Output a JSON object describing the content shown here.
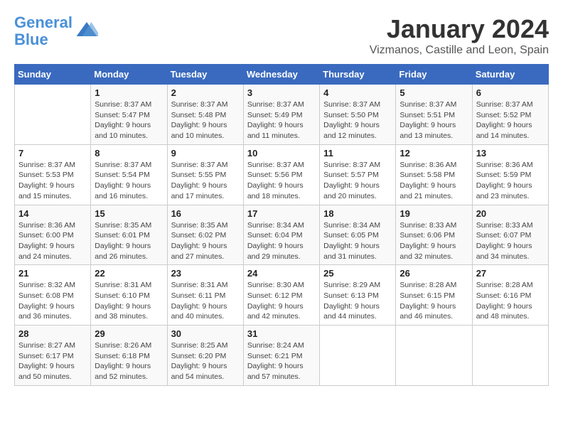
{
  "logo": {
    "line1": "General",
    "line2": "Blue"
  },
  "title": "January 2024",
  "location": "Vizmanos, Castille and Leon, Spain",
  "days_header": [
    "Sunday",
    "Monday",
    "Tuesday",
    "Wednesday",
    "Thursday",
    "Friday",
    "Saturday"
  ],
  "weeks": [
    [
      {
        "day": "",
        "info": ""
      },
      {
        "day": "1",
        "info": "Sunrise: 8:37 AM\nSunset: 5:47 PM\nDaylight: 9 hours\nand 10 minutes."
      },
      {
        "day": "2",
        "info": "Sunrise: 8:37 AM\nSunset: 5:48 PM\nDaylight: 9 hours\nand 10 minutes."
      },
      {
        "day": "3",
        "info": "Sunrise: 8:37 AM\nSunset: 5:49 PM\nDaylight: 9 hours\nand 11 minutes."
      },
      {
        "day": "4",
        "info": "Sunrise: 8:37 AM\nSunset: 5:50 PM\nDaylight: 9 hours\nand 12 minutes."
      },
      {
        "day": "5",
        "info": "Sunrise: 8:37 AM\nSunset: 5:51 PM\nDaylight: 9 hours\nand 13 minutes."
      },
      {
        "day": "6",
        "info": "Sunrise: 8:37 AM\nSunset: 5:52 PM\nDaylight: 9 hours\nand 14 minutes."
      }
    ],
    [
      {
        "day": "7",
        "info": "Sunrise: 8:37 AM\nSunset: 5:53 PM\nDaylight: 9 hours\nand 15 minutes."
      },
      {
        "day": "8",
        "info": "Sunrise: 8:37 AM\nSunset: 5:54 PM\nDaylight: 9 hours\nand 16 minutes."
      },
      {
        "day": "9",
        "info": "Sunrise: 8:37 AM\nSunset: 5:55 PM\nDaylight: 9 hours\nand 17 minutes."
      },
      {
        "day": "10",
        "info": "Sunrise: 8:37 AM\nSunset: 5:56 PM\nDaylight: 9 hours\nand 18 minutes."
      },
      {
        "day": "11",
        "info": "Sunrise: 8:37 AM\nSunset: 5:57 PM\nDaylight: 9 hours\nand 20 minutes."
      },
      {
        "day": "12",
        "info": "Sunrise: 8:36 AM\nSunset: 5:58 PM\nDaylight: 9 hours\nand 21 minutes."
      },
      {
        "day": "13",
        "info": "Sunrise: 8:36 AM\nSunset: 5:59 PM\nDaylight: 9 hours\nand 23 minutes."
      }
    ],
    [
      {
        "day": "14",
        "info": "Sunrise: 8:36 AM\nSunset: 6:00 PM\nDaylight: 9 hours\nand 24 minutes."
      },
      {
        "day": "15",
        "info": "Sunrise: 8:35 AM\nSunset: 6:01 PM\nDaylight: 9 hours\nand 26 minutes."
      },
      {
        "day": "16",
        "info": "Sunrise: 8:35 AM\nSunset: 6:02 PM\nDaylight: 9 hours\nand 27 minutes."
      },
      {
        "day": "17",
        "info": "Sunrise: 8:34 AM\nSunset: 6:04 PM\nDaylight: 9 hours\nand 29 minutes."
      },
      {
        "day": "18",
        "info": "Sunrise: 8:34 AM\nSunset: 6:05 PM\nDaylight: 9 hours\nand 31 minutes."
      },
      {
        "day": "19",
        "info": "Sunrise: 8:33 AM\nSunset: 6:06 PM\nDaylight: 9 hours\nand 32 minutes."
      },
      {
        "day": "20",
        "info": "Sunrise: 8:33 AM\nSunset: 6:07 PM\nDaylight: 9 hours\nand 34 minutes."
      }
    ],
    [
      {
        "day": "21",
        "info": "Sunrise: 8:32 AM\nSunset: 6:08 PM\nDaylight: 9 hours\nand 36 minutes."
      },
      {
        "day": "22",
        "info": "Sunrise: 8:31 AM\nSunset: 6:10 PM\nDaylight: 9 hours\nand 38 minutes."
      },
      {
        "day": "23",
        "info": "Sunrise: 8:31 AM\nSunset: 6:11 PM\nDaylight: 9 hours\nand 40 minutes."
      },
      {
        "day": "24",
        "info": "Sunrise: 8:30 AM\nSunset: 6:12 PM\nDaylight: 9 hours\nand 42 minutes."
      },
      {
        "day": "25",
        "info": "Sunrise: 8:29 AM\nSunset: 6:13 PM\nDaylight: 9 hours\nand 44 minutes."
      },
      {
        "day": "26",
        "info": "Sunrise: 8:28 AM\nSunset: 6:15 PM\nDaylight: 9 hours\nand 46 minutes."
      },
      {
        "day": "27",
        "info": "Sunrise: 8:28 AM\nSunset: 6:16 PM\nDaylight: 9 hours\nand 48 minutes."
      }
    ],
    [
      {
        "day": "28",
        "info": "Sunrise: 8:27 AM\nSunset: 6:17 PM\nDaylight: 9 hours\nand 50 minutes."
      },
      {
        "day": "29",
        "info": "Sunrise: 8:26 AM\nSunset: 6:18 PM\nDaylight: 9 hours\nand 52 minutes."
      },
      {
        "day": "30",
        "info": "Sunrise: 8:25 AM\nSunset: 6:20 PM\nDaylight: 9 hours\nand 54 minutes."
      },
      {
        "day": "31",
        "info": "Sunrise: 8:24 AM\nSunset: 6:21 PM\nDaylight: 9 hours\nand 57 minutes."
      },
      {
        "day": "",
        "info": ""
      },
      {
        "day": "",
        "info": ""
      },
      {
        "day": "",
        "info": ""
      }
    ]
  ]
}
